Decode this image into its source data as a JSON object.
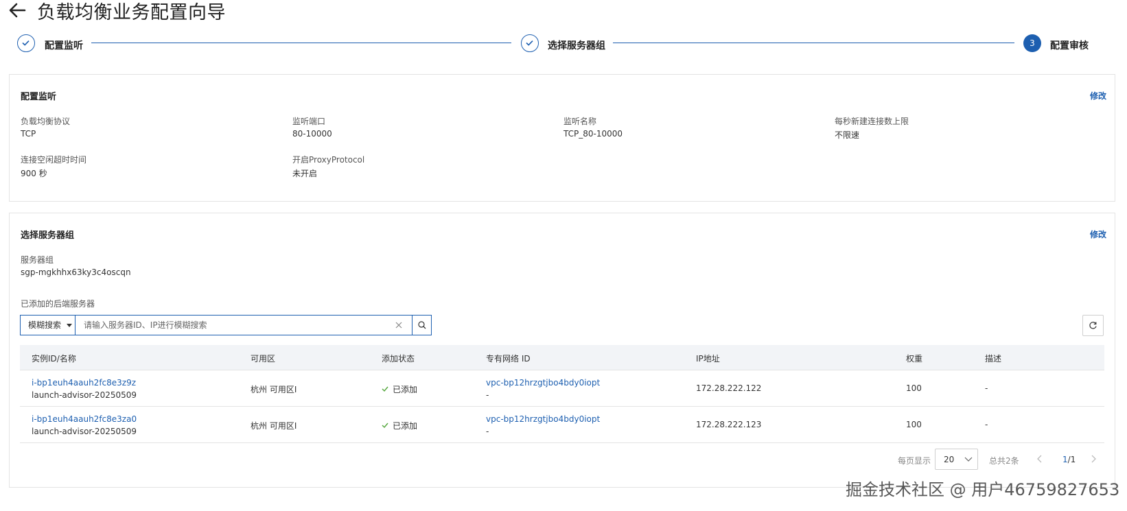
{
  "header": {
    "title": "负载均衡业务配置向导",
    "back_icon": "arrow-left-icon"
  },
  "steps": [
    {
      "label": "配置监听",
      "state": "done"
    },
    {
      "label": "选择服务器组",
      "state": "done"
    },
    {
      "label": "配置审核",
      "state": "active",
      "number": "3"
    }
  ],
  "listener": {
    "title": "配置监听",
    "edit": "修改",
    "fields": [
      {
        "label": "负载均衡协议",
        "value": "TCP"
      },
      {
        "label": "监听端口",
        "value": "80-10000"
      },
      {
        "label": "监听名称",
        "value": "TCP_80-10000"
      },
      {
        "label": "每秒新建连接数上限",
        "value": "不限速"
      },
      {
        "label": "连接空闲超时时间",
        "value": "900 秒"
      },
      {
        "label": "开启ProxyProtocol",
        "value": "未开启"
      }
    ]
  },
  "servergroup": {
    "title": "选择服务器组",
    "edit": "修改",
    "group_label": "服务器组",
    "group_value": "sgp-mgkhhx63ky3c4oscqn",
    "backend_label": "已添加的后端服务器",
    "search": {
      "type_label": "模糊搜索",
      "placeholder": "请输入服务器ID、IP进行模糊搜索"
    },
    "columns": [
      "实例ID/名称",
      "可用区",
      "添加状态",
      "专有网络 ID",
      "IP地址",
      "权重",
      "描述"
    ],
    "rows": [
      {
        "id": "i-bp1euh4aauh2fc8e3z9z",
        "name": "launch-advisor-20250509",
        "zone": "杭州 可用区I",
        "status": "已添加",
        "vpc": "vpc-bp12hrzgtjbo4bdy0iopt",
        "vpc_sub": "-",
        "ip": "172.28.222.122",
        "weight": "100",
        "desc": "-"
      },
      {
        "id": "i-bp1euh4aauh2fc8e3za0",
        "name": "launch-advisor-20250509",
        "zone": "杭州 可用区I",
        "status": "已添加",
        "vpc": "vpc-bp12hrzgtjbo4bdy0iopt",
        "vpc_sub": "-",
        "ip": "172.28.222.123",
        "weight": "100",
        "desc": "-"
      }
    ],
    "pagination": {
      "per_page_label": "每页显示",
      "per_page": "20",
      "total": "总共2条",
      "page_current": "1",
      "page_total": "/1"
    }
  },
  "watermark": "掘金技术社区 @ 用户46759827653",
  "colors": {
    "accent": "#1d5fb0",
    "success": "#52a63a"
  }
}
